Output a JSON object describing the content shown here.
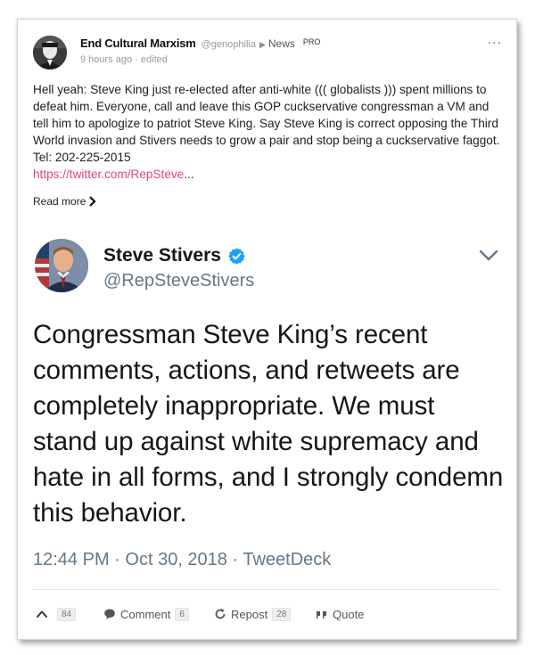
{
  "post": {
    "author_name": "End Cultural Marxism",
    "author_handle": "@genophilia",
    "group_arrow": "▶",
    "group_name": "News",
    "pro_badge": "PRO",
    "time": "9 hours ago",
    "edited": "edited",
    "more_menu": "...",
    "body_text": "Hell yeah: Steve King just re-elected after anti-white ((( globalists ))) spent millions to defeat him. Everyone, call and leave this GOP cuckservative congressman a VM and tell him to apologize to patriot Steve King. Say Steve King is correct opposing the Third World invasion and Stivers needs to grow a pair and stop being a cuckservative faggot.  Tel: 202-225-2015",
    "link_text": "https://twitter.com/RepSteve",
    "link_ellipsis": "...",
    "read_more": "Read more",
    "read_more_chevron": "›"
  },
  "tweet": {
    "name": "Steve Stivers",
    "handle": "@RepSteveStivers",
    "text": "Congressman Steve King’s recent comments, actions, and retweets are completely inappropriate. We must stand up against white supremacy and hate in all forms, and I strongly condemn this behavior.",
    "time": "12:44 PM",
    "date": "Oct 30, 2018",
    "client": "TweetDeck",
    "separator": "·"
  },
  "actions": {
    "upvote_count": "84",
    "comment_label": "Comment",
    "comment_count": "6",
    "repost_label": "Repost",
    "repost_count": "28",
    "quote_label": "Quote"
  },
  "colors": {
    "link": "#e0457b",
    "twitter_gray": "#657786",
    "verified_blue": "#1da1f2"
  },
  "icons": [
    "more-dots-icon",
    "chevron-right-icon",
    "verified-badge-icon",
    "chevron-down-icon",
    "upvote-icon",
    "comment-icon",
    "repost-icon",
    "quote-icon"
  ]
}
